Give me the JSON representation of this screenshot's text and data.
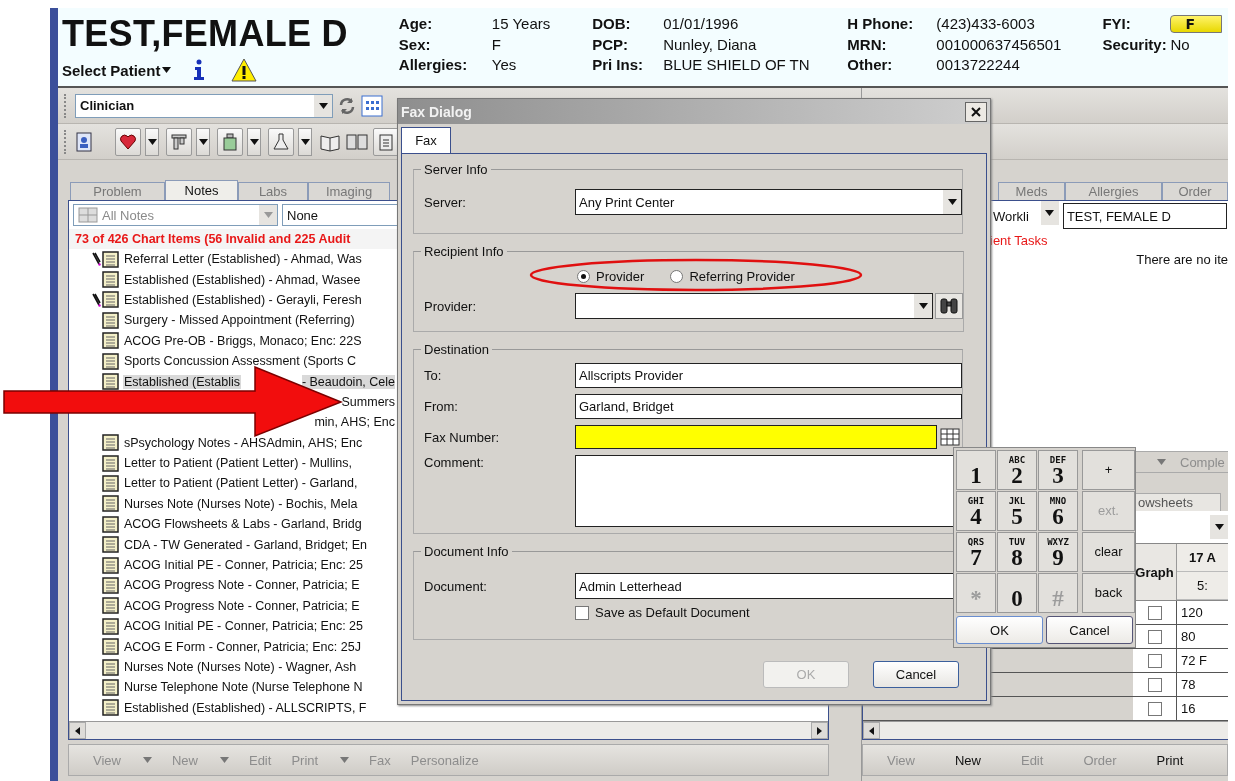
{
  "patient_header": {
    "name": "TEST,FEMALE D",
    "select_label": "Select Patient",
    "field_columns": [
      [
        {
          "label": "Age:",
          "value": "15 Years"
        },
        {
          "label": "Sex:",
          "value": "F"
        },
        {
          "label": "Allergies:",
          "value": "Yes"
        }
      ],
      [
        {
          "label": "DOB:",
          "value": "01/01/1996"
        },
        {
          "label": "PCP:",
          "value": "Nunley, Diana"
        },
        {
          "label": "Pri Ins:",
          "value": "BLUE SHIELD OF TN"
        }
      ],
      [
        {
          "label": "H Phone:",
          "value": "(423)433-6003"
        },
        {
          "label": "MRN:",
          "value": "001000637456501"
        },
        {
          "label": "Other:",
          "value": "0013722244"
        }
      ],
      [
        {
          "label": "FYI:",
          "value": "F",
          "kind": "flag"
        },
        {
          "label": "Security:",
          "value": "No",
          "kind": "text"
        }
      ]
    ]
  },
  "left_pane": {
    "view_selector": "Clinician",
    "tabs": [
      {
        "label": "Problem",
        "selected": false
      },
      {
        "label": "Notes",
        "selected": true
      },
      {
        "label": "Labs",
        "selected": false
      },
      {
        "label": "Imaging",
        "selected": false
      }
    ],
    "filters": [
      {
        "value": "All Notes",
        "disabled": true
      },
      {
        "value": "None",
        "disabled": false
      }
    ],
    "summary": "73 of 426 Chart Items (56 Invalid and 225 Audit",
    "items": [
      {
        "kind": "note",
        "text": "Referral Letter (Established) - Ahmad, Was",
        "annotated": true,
        "selected": false
      },
      {
        "kind": "note",
        "text": "Established (Established) - Ahmad, Wasee",
        "annotated": false,
        "selected": false
      },
      {
        "kind": "note",
        "text": "Established (Established) - Gerayli, Feresh",
        "annotated": true,
        "selected": false
      },
      {
        "kind": "note",
        "text": "Surgery - Missed Appointment (Referring)",
        "annotated": false,
        "selected": false
      },
      {
        "kind": "note",
        "text": "ACOG Pre-OB - Briggs, Monaco; Enc: 22S",
        "annotated": false,
        "selected": false
      },
      {
        "kind": "note",
        "text": "Sports Concussion Assessment (Sports C",
        "annotated": false,
        "selected": false
      },
      {
        "kind": "split",
        "text": "Established (Establis",
        "trail": "- Beaudoin, Cele",
        "annotated": false,
        "selected": true
      },
      {
        "kind": "covered",
        "text": "Summers",
        "selected": false
      },
      {
        "kind": "covered",
        "text": "min, AHS; Enc",
        "selected": false
      },
      {
        "kind": "note",
        "text": "sPsychology Notes - AHSAdmin, AHS; Enc",
        "annotated": false,
        "selected": false
      },
      {
        "kind": "note",
        "text": "Letter to Patient (Patient Letter) - Mullins,",
        "annotated": false,
        "selected": false
      },
      {
        "kind": "note",
        "text": "Letter to Patient (Patient Letter) - Garland,",
        "annotated": false,
        "selected": false
      },
      {
        "kind": "note",
        "text": "Nurses Note (Nurses Note) - Bochis, Mela",
        "annotated": false,
        "selected": false
      },
      {
        "kind": "note",
        "text": "ACOG Flowsheets & Labs - Garland, Bridg",
        "annotated": false,
        "selected": false
      },
      {
        "kind": "note",
        "text": "CDA - TW Generated - Garland, Bridget; En",
        "annotated": false,
        "selected": false
      },
      {
        "kind": "note",
        "text": "ACOG Initial PE - Conner, Patricia; Enc: 25",
        "annotated": false,
        "selected": false
      },
      {
        "kind": "note",
        "text": "ACOG Progress Note - Conner, Patricia; E",
        "annotated": false,
        "selected": false
      },
      {
        "kind": "note",
        "text": "ACOG Progress Note - Conner, Patricia; E",
        "annotated": false,
        "selected": false
      },
      {
        "kind": "note",
        "text": "ACOG Initial PE - Conner, Patricia; Enc: 25",
        "annotated": false,
        "selected": false
      },
      {
        "kind": "note",
        "text": "ACOG E Form - Conner, Patricia; Enc: 25J",
        "annotated": false,
        "selected": false
      },
      {
        "kind": "note",
        "text": "Nurses Note (Nurses Note) - Wagner, Ash",
        "annotated": false,
        "selected": false
      },
      {
        "kind": "note",
        "text": "Nurse Telephone Note (Nurse Telephone N",
        "annotated": false,
        "selected": false
      },
      {
        "kind": "note",
        "text": "Established (Established) - ALLSCRIPTS, F",
        "annotated": false,
        "selected": false
      }
    ],
    "actions": [
      {
        "label": "View",
        "dropdown": true,
        "disabled": true
      },
      {
        "label": "New",
        "dropdown": true,
        "disabled": true
      },
      {
        "label": "Edit",
        "dropdown": false,
        "disabled": true
      },
      {
        "label": "Print",
        "dropdown": true,
        "disabled": true
      },
      {
        "label": "Fax",
        "dropdown": false,
        "disabled": true
      },
      {
        "label": "Personalize",
        "dropdown": false,
        "disabled": true
      }
    ]
  },
  "right_pane": {
    "tabs": [
      {
        "label": "Meds",
        "selected": false
      },
      {
        "label": "Allergies",
        "selected": false
      },
      {
        "label": "Order",
        "selected": false
      }
    ],
    "worklist_selector": "Workli",
    "patient_field": "TEST, FEMALE D",
    "task_heading": "ient Tasks",
    "empty_message": "There are no ite",
    "section_bar": "Comple",
    "lower_tab": "owsheets",
    "flowsheet": {
      "graph_header": "Graph",
      "date_header": "17 A",
      "time_header": "5:",
      "rows": [
        {
          "value": "120",
          "checked": false
        },
        {
          "value": "80",
          "checked": false
        },
        {
          "value": "72 F",
          "checked": false
        },
        {
          "value": "78",
          "checked": false
        },
        {
          "value": "16",
          "checked": false
        }
      ]
    },
    "actions": [
      {
        "label": "View",
        "disabled": true
      },
      {
        "label": "New",
        "disabled": false
      },
      {
        "label": "Edit",
        "disabled": true
      },
      {
        "label": "Order",
        "disabled": true
      },
      {
        "label": "Print",
        "disabled": false
      }
    ]
  },
  "fax_dialog": {
    "title": "Fax Dialog",
    "tabs": [
      {
        "label": "Fax",
        "selected": true
      }
    ],
    "server_info": {
      "legend": "Server Info",
      "label": "Server:",
      "value": "Any Print Center"
    },
    "recipient_info": {
      "legend": "Recipient Info",
      "options": [
        {
          "label": "Provider",
          "selected": true
        },
        {
          "label": "Referring Provider",
          "selected": false
        }
      ],
      "provider_label": "Provider:"
    },
    "destination": {
      "legend": "Destination",
      "to_label": "To:",
      "to_value": "Allscripts Provider",
      "from_label": "From:",
      "from_value": "Garland, Bridget",
      "fax_label": "Fax Number:",
      "fax_highlighted": true,
      "comment_label": "Comment:"
    },
    "document_info": {
      "legend": "Document Info",
      "label": "Document:",
      "value": "Admin Letterhead",
      "default_checkbox": {
        "label": "Save as Default Document",
        "checked": false
      }
    },
    "buttons": [
      {
        "label": "OK",
        "disabled": true
      },
      {
        "label": "Cancel",
        "disabled": false
      }
    ]
  },
  "keypad": {
    "keys": [
      {
        "kind": "digit",
        "label": "1",
        "disabled": false
      },
      {
        "kind": "digit",
        "label": "2",
        "letters": "ABC",
        "disabled": false
      },
      {
        "kind": "digit",
        "label": "3",
        "letters": "DEF",
        "disabled": false
      },
      {
        "kind": "action",
        "label": "+",
        "disabled": false
      },
      {
        "kind": "digit",
        "label": "4",
        "letters": "GHI",
        "disabled": false
      },
      {
        "kind": "digit",
        "label": "5",
        "letters": "JKL",
        "disabled": false
      },
      {
        "kind": "digit",
        "label": "6",
        "letters": "MNO",
        "disabled": false
      },
      {
        "kind": "action",
        "label": "ext.",
        "disabled": true
      },
      {
        "kind": "digit",
        "label": "7",
        "letters": "QRS",
        "disabled": false
      },
      {
        "kind": "digit",
        "label": "8",
        "letters": "TUV",
        "disabled": false
      },
      {
        "kind": "digit",
        "label": "9",
        "letters": "WXYZ",
        "disabled": false
      },
      {
        "kind": "action",
        "label": "clear",
        "disabled": false
      },
      {
        "kind": "digit",
        "label": "*",
        "disabled": true
      },
      {
        "kind": "digit",
        "label": "0",
        "disabled": false
      },
      {
        "kind": "digit",
        "label": "#",
        "disabled": true
      },
      {
        "kind": "action",
        "label": "back",
        "disabled": false
      }
    ],
    "buttons": [
      {
        "label": "OK",
        "focused": true
      },
      {
        "label": "Cancel",
        "focused": false
      }
    ]
  }
}
